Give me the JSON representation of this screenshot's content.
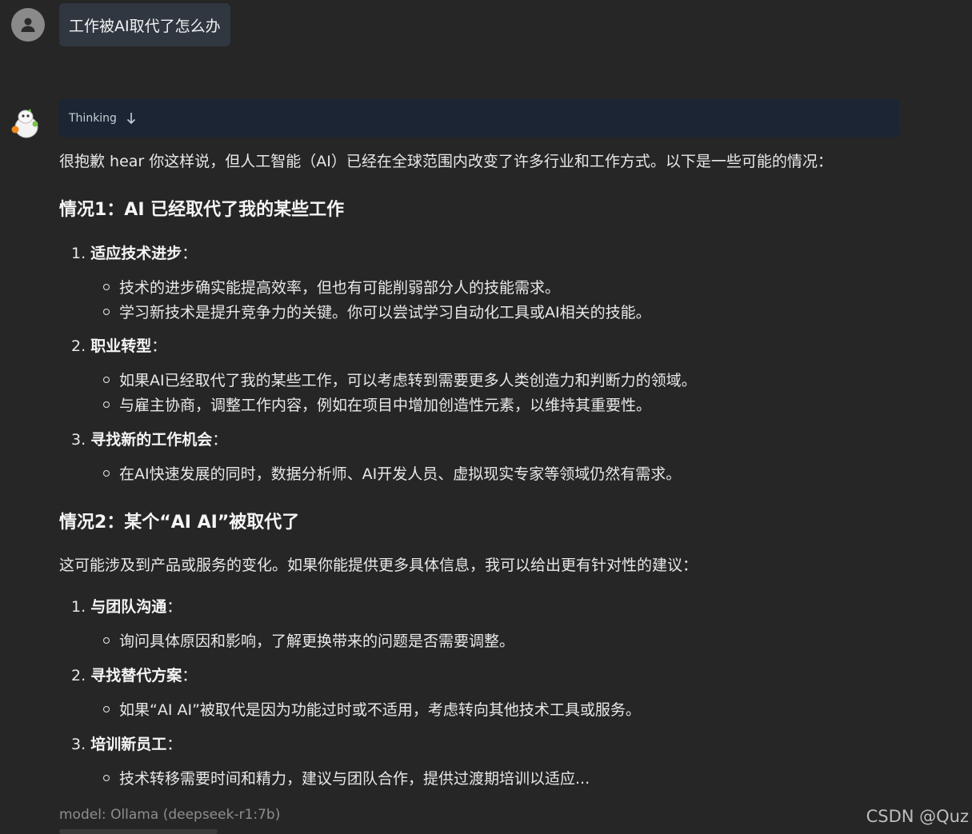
{
  "user_message": "工作被AI取代了怎么办",
  "thinking": {
    "label": "Thinking"
  },
  "response": {
    "intro": "很抱歉 hear 你这样说，但人工智能（AI）已经在全球范围内改变了许多行业和工作方式。以下是一些可能的情况：",
    "section1": {
      "title": "情况1：AI 已经取代了我的某些工作",
      "items": [
        {
          "num": "1.",
          "title": "适应技术进步",
          "colon": "：",
          "bullets": [
            "技术的进步确实能提高效率，但也有可能削弱部分人的技能需求。",
            "学习新技术是提升竞争力的关键。你可以尝试学习自动化工具或AI相关的技能。"
          ]
        },
        {
          "num": "2.",
          "title": "职业转型",
          "colon": "：",
          "bullets": [
            "如果AI已经取代了我的某些工作，可以考虑转到需要更多人类创造力和判断力的领域。",
            "与雇主协商，调整工作内容，例如在项目中增加创造性元素，以维持其重要性。"
          ]
        },
        {
          "num": "3.",
          "title": "寻找新的工作机会",
          "colon": "：",
          "bullets": [
            "在AI快速发展的同时，数据分析师、AI开发人员、虚拟现实专家等领域仍然有需求。"
          ]
        }
      ]
    },
    "section2": {
      "title": "情况2：某个“AI AI”被取代了",
      "intro": "这可能涉及到产品或服务的变化。如果你能提供更多具体信息，我可以给出更有针对性的建议：",
      "items": [
        {
          "num": "1.",
          "title": "与团队沟通",
          "colon": "：",
          "bullets": [
            "询问具体原因和影响，了解更换带来的问题是否需要调整。"
          ]
        },
        {
          "num": "2.",
          "title": "寻找替代方案",
          "colon": "：",
          "bullets": [
            "如果“AI AI”被取代是因为功能过时或不适用，考虑转向其他技术工具或服务。"
          ]
        },
        {
          "num": "3.",
          "title": "培训新员工",
          "colon": "：",
          "bullets": [
            "技术转移需要时间和精力，建议与团队合作，提供过渡期培训以适应..."
          ]
        }
      ]
    }
  },
  "model_label": "model: Ollama (deepseek-r1:7b)",
  "watermark": "CSDN @Quz",
  "colors": {
    "background": "#262626",
    "user_bubble": "#303741",
    "thinking_bg": "#1c2533"
  }
}
